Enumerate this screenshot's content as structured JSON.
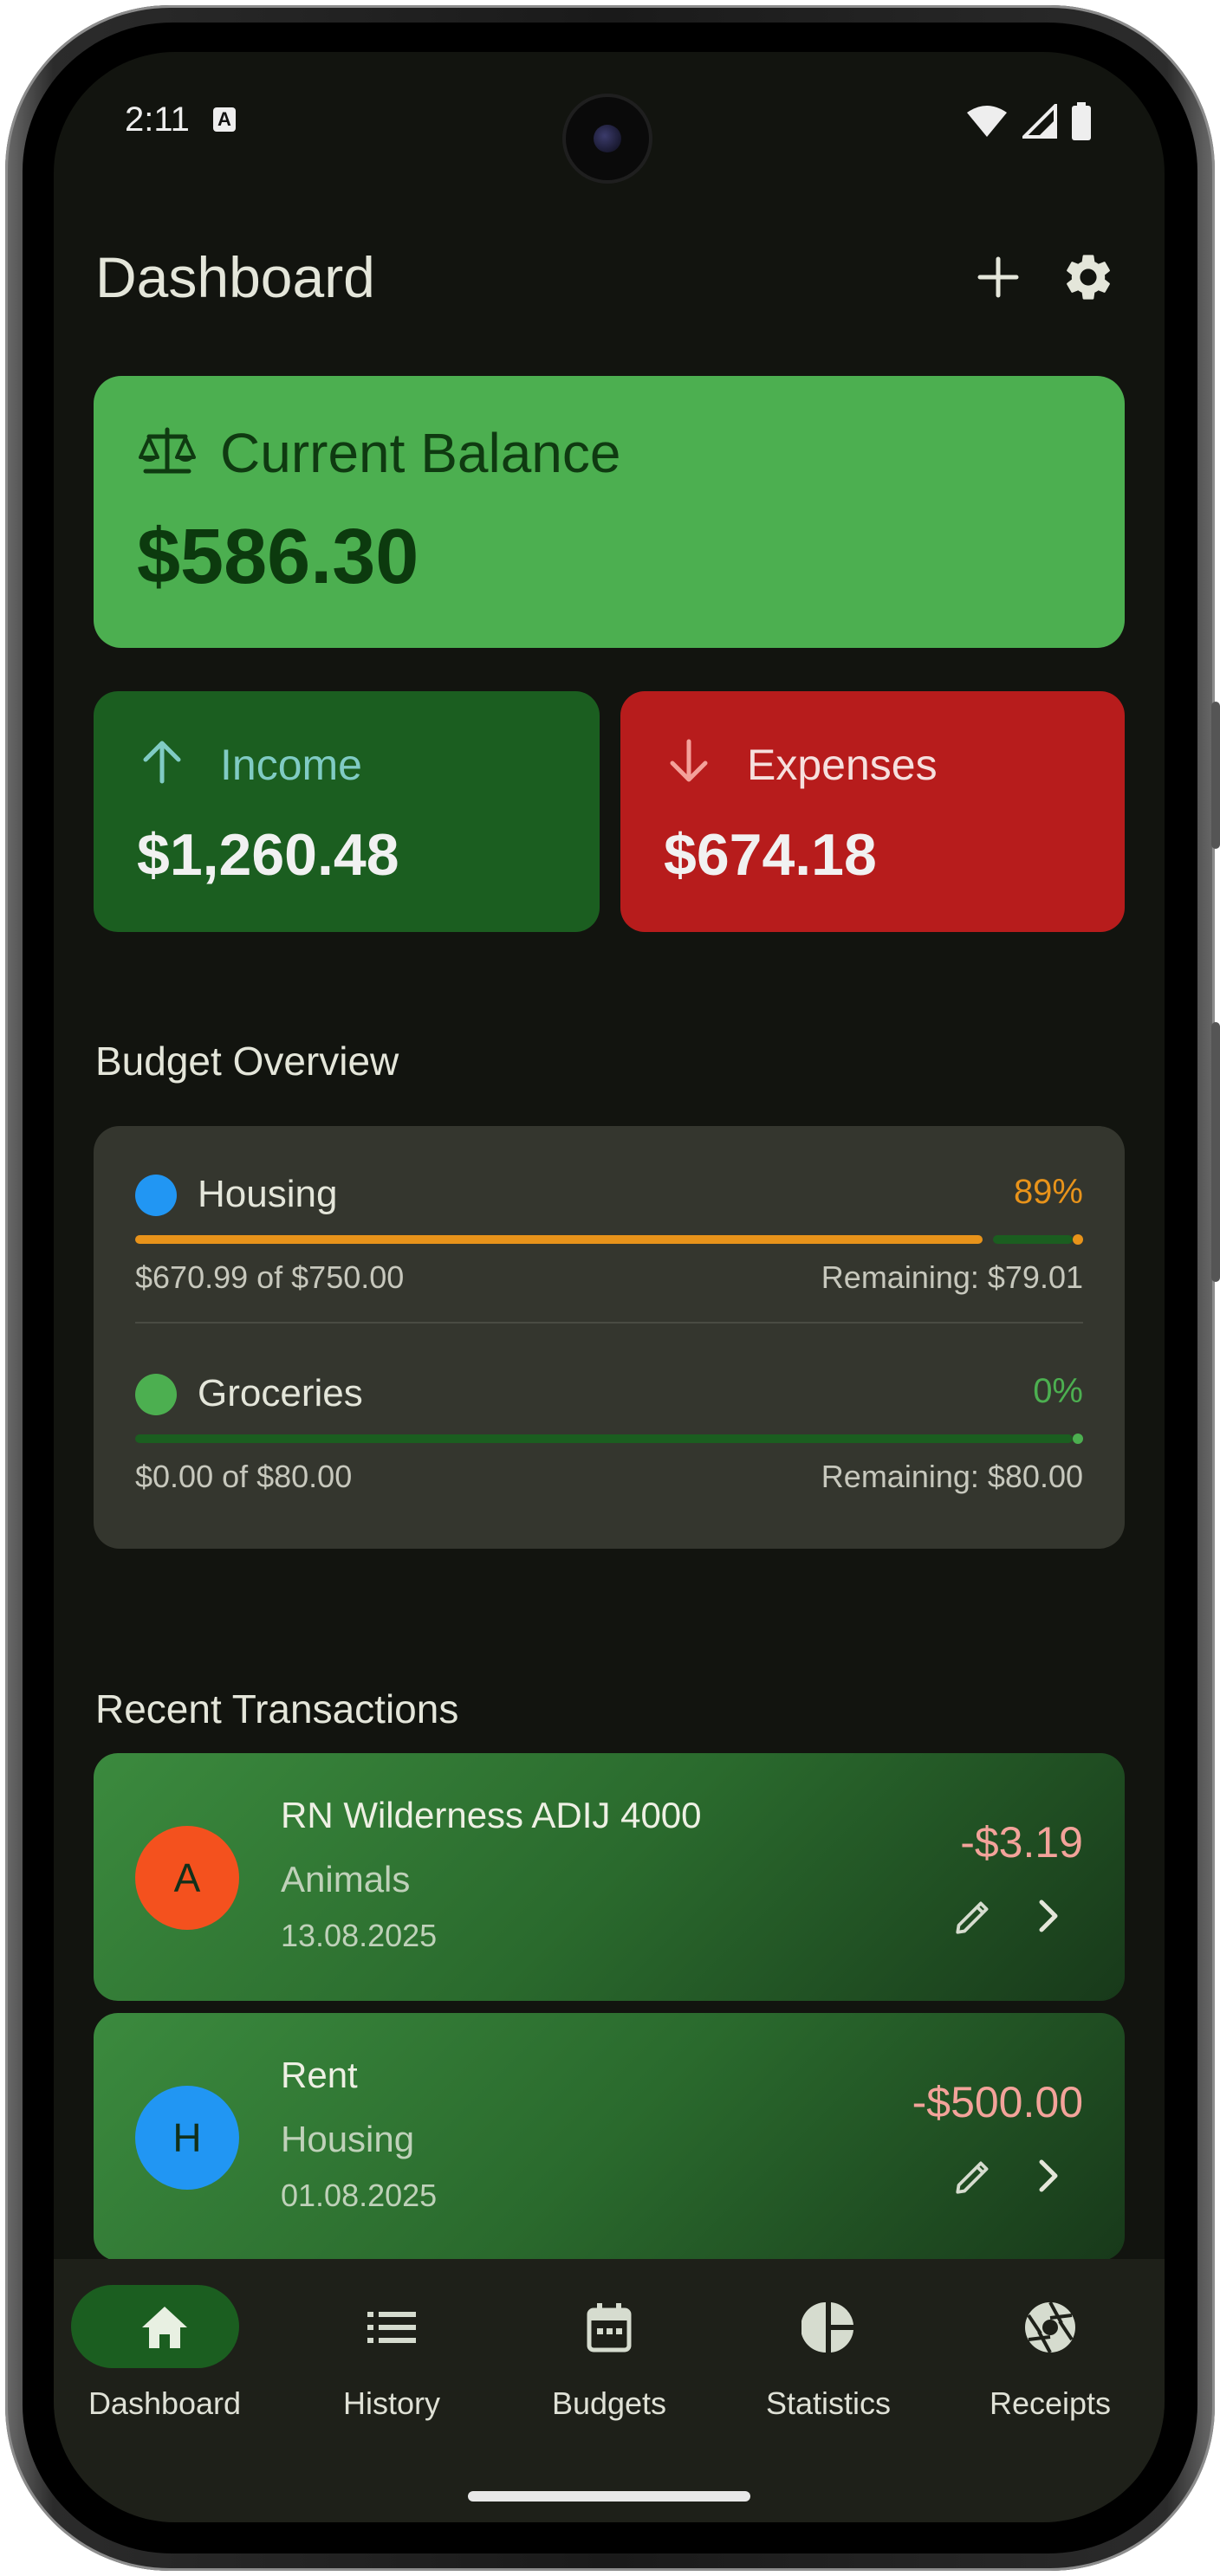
{
  "status_bar": {
    "time": "2:11",
    "notification_glyph": "A"
  },
  "header": {
    "title": "Dashboard",
    "add_icon": "plus-icon",
    "settings_icon": "gear-icon"
  },
  "balance": {
    "label": "Current Balance",
    "value": "$586.30",
    "icon": "scale-icon"
  },
  "income": {
    "label": "Income",
    "value": "$1,260.48",
    "icon": "arrow-up-icon",
    "label_color": "#80cbc4"
  },
  "expenses": {
    "label": "Expenses",
    "value": "$674.18",
    "icon": "arrow-down-icon",
    "icon_color": "#f4a19a"
  },
  "budget_overview": {
    "title": "Budget Overview",
    "items": [
      {
        "name": "Housing",
        "percent": "89%",
        "progress": 0.89,
        "dot_color": "#2196f3",
        "pct_color": "#e8931a",
        "spent": "$670.99 of $750.00",
        "remaining": "Remaining: $79.01"
      },
      {
        "name": "Groceries",
        "percent": "0%",
        "progress": 0.0,
        "dot_color": "#4caf50",
        "pct_color": "#4caf50",
        "spent": "$0.00 of $80.00",
        "remaining": "Remaining: $80.00"
      }
    ]
  },
  "recent_transactions": {
    "title": "Recent Transactions",
    "items": [
      {
        "avatar": "A",
        "avatar_color": "#f4511e",
        "title": "RN Wilderness ADIJ 4000",
        "category": "Animals",
        "date": "13.08.2025",
        "amount": "-$3.19"
      },
      {
        "avatar": "H",
        "avatar_color": "#2196f3",
        "title": "Rent",
        "category": "Housing",
        "date": "01.08.2025",
        "amount": "-$500.00"
      }
    ]
  },
  "bottom_nav": {
    "items": [
      {
        "label": "Dashboard",
        "icon": "home-icon",
        "active": true
      },
      {
        "label": "History",
        "icon": "list-icon",
        "active": false
      },
      {
        "label": "Budgets",
        "icon": "calendar-icon",
        "active": false
      },
      {
        "label": "Statistics",
        "icon": "pie-chart-icon",
        "active": false
      },
      {
        "label": "Receipts",
        "icon": "aperture-icon",
        "active": false
      }
    ]
  },
  "colors": {
    "background": "#12140f",
    "balance_card": "#4caf50",
    "income_card": "#1b5e20",
    "expense_card": "#b71c1c",
    "accent": "#4caf50"
  }
}
